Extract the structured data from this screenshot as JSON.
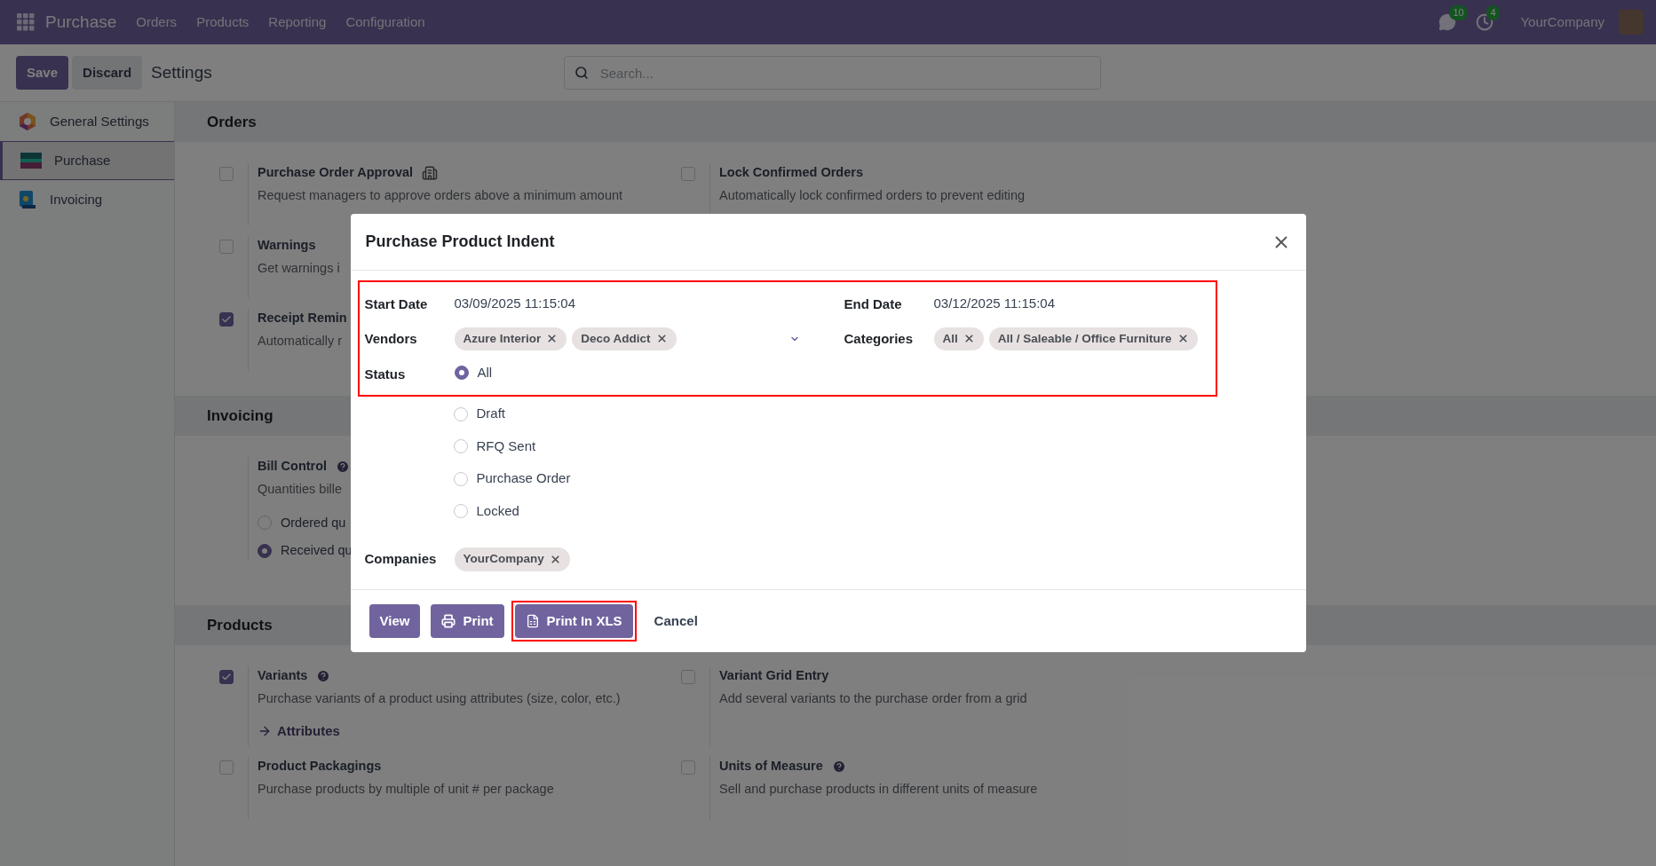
{
  "navbar": {
    "app": "Purchase",
    "menu": [
      "Orders",
      "Products",
      "Reporting",
      "Configuration"
    ],
    "messages_count": "10",
    "activities_count": "4",
    "company": "YourCompany"
  },
  "control_panel": {
    "buttons": [
      {
        "label": "Save",
        "kind": "primary"
      },
      {
        "label": "Discard",
        "kind": "secondary"
      }
    ],
    "title": "Settings",
    "search": {
      "placeholder": "Search..."
    }
  },
  "sidebar": {
    "items": [
      {
        "label": "General Settings",
        "selected": false
      },
      {
        "label": "Purchase",
        "selected": true
      },
      {
        "label": "Invoicing",
        "selected": false
      }
    ]
  },
  "sections": [
    {
      "title": "Orders",
      "rows": [
        [
          {
            "kind": "checkbox",
            "title": "Purchase Order Approval",
            "enterprise_only": true,
            "checked": false,
            "description": "Request managers to approve orders above a minimum amount"
          },
          {
            "kind": "checkbox",
            "title": "Lock Confirmed Orders",
            "checked": false,
            "description": "Automatically lock confirmed orders to prevent editing"
          }
        ],
        [
          {
            "kind": "checkbox",
            "title": "Warnings",
            "checked": false,
            "description": "Get warnings i"
          }
        ],
        [
          {
            "kind": "checkbox",
            "title": "Receipt Remin",
            "checked": true,
            "description": "Automatically r"
          }
        ]
      ]
    },
    {
      "title": "Invoicing",
      "rows": [
        [
          {
            "kind": "radio_group",
            "title": "Bill Control",
            "help_tip": true,
            "description": "Quantities bille",
            "options": [
              {
                "label": "Ordered qu",
                "selected": false
              },
              {
                "label": "Received qu",
                "selected": true
              }
            ]
          }
        ]
      ]
    },
    {
      "title": "Products",
      "rows": [
        [
          {
            "kind": "checkbox",
            "title": "Variants",
            "help_tip": true,
            "checked": true,
            "description": "Purchase variants of a product using attributes (size, color, etc.)",
            "link": "Attributes"
          },
          {
            "kind": "checkbox",
            "title": "Variant Grid Entry",
            "checked": false,
            "description": "Add several variants to the purchase order from a grid"
          }
        ],
        [
          {
            "kind": "checkbox",
            "title": "Product Packagings",
            "checked": false,
            "description": "Purchase products by multiple of unit # per package"
          },
          {
            "kind": "checkbox",
            "title": "Units of Measure",
            "help_tip": true,
            "checked": false,
            "description": "Sell and purchase products in different units of measure"
          }
        ]
      ]
    }
  ],
  "dialog": {
    "title": "Purchase Product Indent",
    "highlighted": true,
    "start_date": {
      "label": "Start Date",
      "value": "03/09/2025 11:15:04"
    },
    "end_date": {
      "label": "End Date",
      "value": "03/12/2025 11:15:04"
    },
    "vendors": {
      "label": "Vendors",
      "tags": [
        "Azure Interior",
        "Deco Addict"
      ]
    },
    "categories": {
      "label": "Categories",
      "tags": [
        "All",
        "All / Saleable / Office Furniture"
      ]
    },
    "status": {
      "label": "Status",
      "options": [
        {
          "label": "All",
          "selected": true
        },
        {
          "label": "Draft",
          "selected": false
        },
        {
          "label": "RFQ Sent",
          "selected": false
        },
        {
          "label": "Purchase Order",
          "selected": false
        },
        {
          "label": "Locked",
          "selected": false
        }
      ]
    },
    "companies": {
      "label": "Companies",
      "tags": [
        "YourCompany"
      ]
    },
    "buttons": [
      {
        "label": "View",
        "kind": "view",
        "highlighted": false
      },
      {
        "label": "Print",
        "kind": "print",
        "highlighted": false
      },
      {
        "label": "Print In XLS",
        "kind": "xls",
        "highlighted": true
      },
      {
        "label": "Cancel",
        "kind": "cancel",
        "highlighted": false
      }
    ]
  }
}
